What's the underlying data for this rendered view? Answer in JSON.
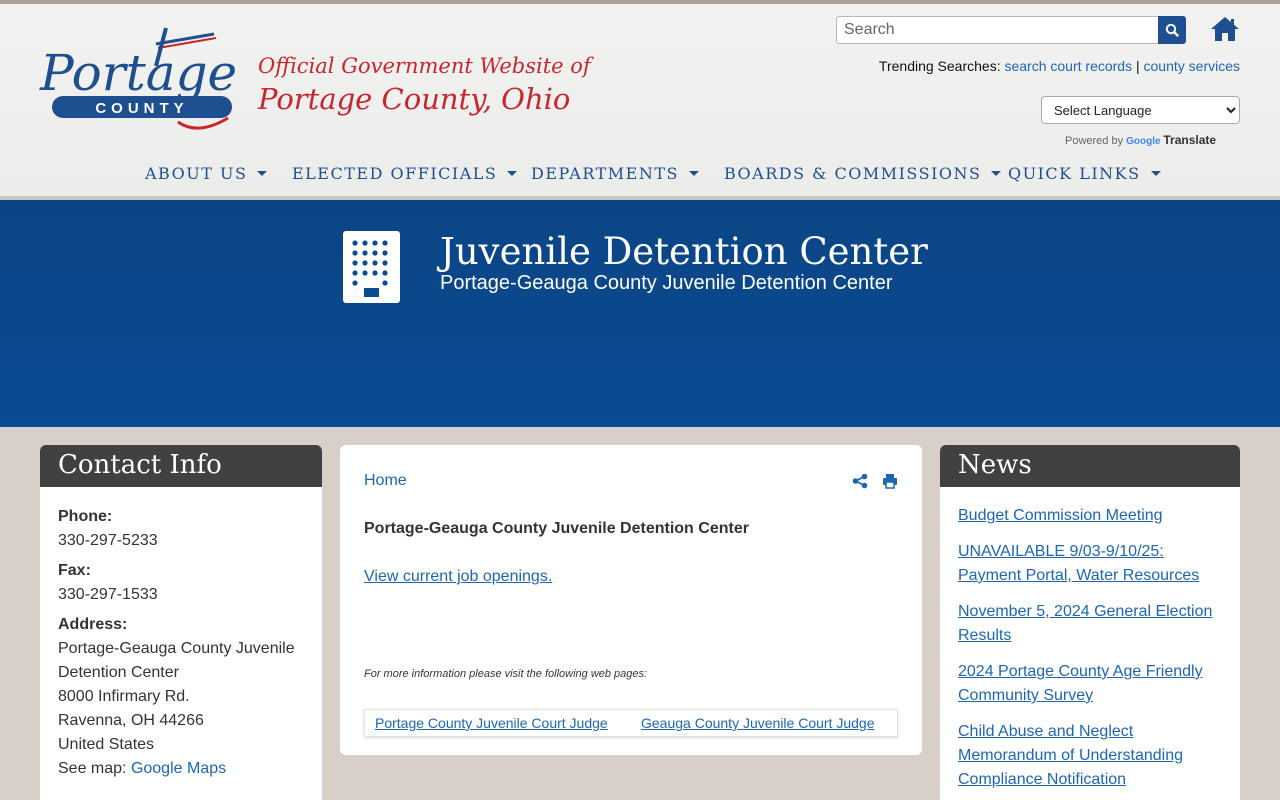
{
  "header": {
    "logo_text": "Portage",
    "logo_sub": "COUNTY",
    "tagline_line1": "Official Government Website of",
    "tagline_line2": "Portage County, Ohio",
    "search_placeholder": "Search",
    "trending_label": "Trending Searches:",
    "trending_links": [
      "search court records",
      "county services"
    ],
    "trending_separator": "|",
    "language_select": "Select Language",
    "powered_by": "Powered by",
    "google_label": "Google",
    "translate_label": "Translate"
  },
  "nav": {
    "items": [
      {
        "label": "ABOUT US"
      },
      {
        "label": "ELECTED OFFICIALS"
      },
      {
        "label": "DEPARTMENTS"
      },
      {
        "label": "BOARDS & COMMISSIONS"
      },
      {
        "label": "QUICK LINKS"
      }
    ]
  },
  "banner": {
    "title": "Juvenile Detention Center",
    "subtitle": "Portage-Geauga County Juvenile Detention Center",
    "icon": "building-icon",
    "color": "#0a4b94"
  },
  "contact": {
    "heading": "Contact Info",
    "phone_label": "Phone:",
    "phone": "330-297-5233",
    "fax_label": "Fax:",
    "fax": "330-297-1533",
    "address_label": "Address:",
    "address_lines": [
      "Portage-Geauga County Juvenile",
      "Detention Center",
      "8000 Infirmary Rd.",
      "Ravenna, OH 44266",
      "United States"
    ],
    "map_label": "See map:",
    "map_link": "Google Maps"
  },
  "main": {
    "breadcrumb": "Home",
    "title": "Portage-Geauga County Juvenile Detention Center",
    "job_link": "View current job openings.",
    "more_info": "For more information please visit the following web pages:",
    "links": [
      "Portage County Juvenile Court Judge",
      "Geauga County Juvenile Court Judge"
    ]
  },
  "news": {
    "heading": "News",
    "items": [
      "Budget Commission Meeting",
      "UNAVAILABLE 9/03-9/10/25: Payment Portal, Water Resources",
      "November 5, 2024 General Election Results",
      "2024 Portage County Age Friendly Community Survey",
      "Child Abuse and Neglect Memorandum of Understanding Compliance Notification"
    ]
  },
  "colors": {
    "brand_blue": "#1d4f91",
    "brand_red": "#c8262c",
    "link": "#1d66b5",
    "panel_head": "#414141"
  }
}
